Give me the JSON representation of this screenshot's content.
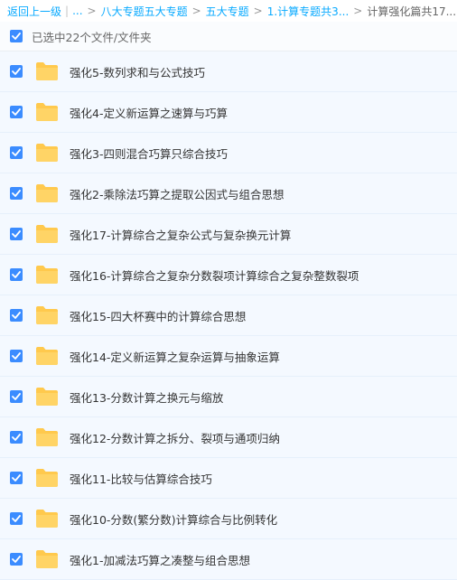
{
  "breadcrumb": {
    "back": "返回上一级",
    "ellipsis": "...",
    "items": [
      "八大专题五大专题",
      "五大专题",
      "1.计算专题共3..."
    ],
    "current": "计算强化篇共17..."
  },
  "selection": {
    "summary": "已选中22个文件/文件夹"
  },
  "icons": {
    "checkbox": "checkbox-checked-icon",
    "folder": "folder-icon"
  },
  "colors": {
    "link": "#09aaff",
    "checkbox": "#3b8cff",
    "row_bg": "#f4f9ff",
    "folder": "#ffc94d"
  },
  "files": [
    {
      "name": "强化5-数列求和与公式技巧"
    },
    {
      "name": "强化4-定义新运算之速算与巧算"
    },
    {
      "name": "强化3-四则混合巧算只综合技巧"
    },
    {
      "name": "强化2-乘除法巧算之提取公因式与组合思想"
    },
    {
      "name": "强化17-计算综合之复杂公式与复杂换元计算"
    },
    {
      "name": "强化16-计算综合之复杂分数裂项计算综合之复杂整数裂项"
    },
    {
      "name": "强化15-四大杯赛中的计算综合思想"
    },
    {
      "name": "强化14-定义新运算之复杂运算与抽象运算"
    },
    {
      "name": "强化13-分数计算之换元与缩放"
    },
    {
      "name": "强化12-分数计算之拆分、裂项与通项归纳"
    },
    {
      "name": "强化11-比较与估算综合技巧"
    },
    {
      "name": "强化10-分数(繁分数)计算综合与比例转化"
    },
    {
      "name": "强化1-加减法巧算之凑整与组合思想"
    }
  ]
}
